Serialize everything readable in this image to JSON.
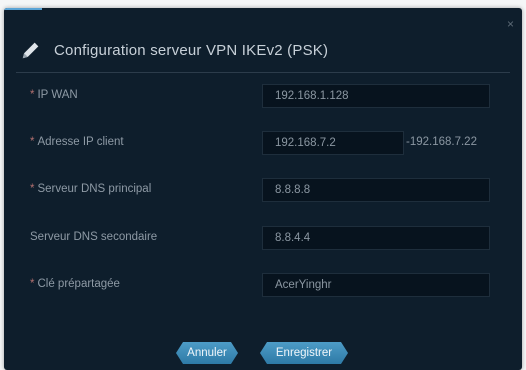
{
  "dialog": {
    "title": "Configuration serveur VPN IKEv2 (PSK)",
    "close_glyph": "×",
    "icon": "pencil-icon"
  },
  "fields": {
    "ip_wan": {
      "label": "IP WAN",
      "value": "192.168.1.128",
      "required": true
    },
    "client_ip": {
      "label": "Adresse IP client",
      "value": "192.168.7.2",
      "range_end": "-192.168.7.22",
      "required": true
    },
    "dns_primary": {
      "label": "Serveur DNS principal",
      "value": "8.8.8.8",
      "required": true
    },
    "dns_secondary": {
      "label": "Serveur DNS secondaire",
      "value": "8.8.4.4",
      "required": false
    },
    "psk": {
      "label": "Clé prépartagée",
      "value": "AcerYinghr",
      "required": true
    }
  },
  "buttons": {
    "cancel": "Annuler",
    "save": "Enregistrer"
  },
  "required_mark": "*"
}
